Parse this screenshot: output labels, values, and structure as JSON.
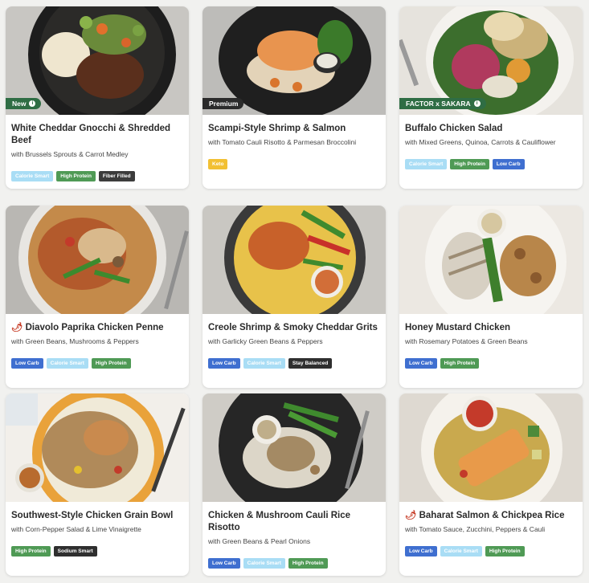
{
  "cards": [
    {
      "title": "White Cheddar Gnocchi & Shredded Beef",
      "subtitle": "with Brussels Sprouts & Carrot Medley",
      "badge": "New",
      "tags": [
        "Calorie Smart",
        "High Protein",
        "Fiber Filled"
      ]
    },
    {
      "title": "Scampi-Style Shrimp & Salmon",
      "subtitle": "with Tomato Cauli Risotto & Parmesan Broccolini",
      "badge": "Premium",
      "tags": [
        "Keto"
      ]
    },
    {
      "title": "Buffalo Chicken Salad",
      "subtitle": "with Mixed Greens, Quinoa, Carrots & Cauliflower",
      "badge": "FACTOR x SAKARA",
      "tags": [
        "Calorie Smart",
        "High Protein",
        "Low Carb"
      ]
    },
    {
      "title": "Diavolo Paprika Chicken Penne",
      "subtitle": "with Green Beans, Mushrooms & Peppers",
      "badge": "",
      "tags": [
        "Low Carb",
        "Calorie Smart",
        "High Protein"
      ]
    },
    {
      "title": "Creole Shrimp & Smoky Cheddar Grits",
      "subtitle": "with Garlicky Green Beans & Peppers",
      "badge": "",
      "tags": [
        "Low Carb",
        "Calorie Smart",
        "Stay Balanced"
      ]
    },
    {
      "title": "Honey Mustard Chicken",
      "subtitle": "with Rosemary Potatoes & Green Beans",
      "badge": "",
      "tags": [
        "Low Carb",
        "High Protein"
      ]
    },
    {
      "title": "Southwest-Style Chicken Grain Bowl",
      "subtitle": "with Corn-Pepper Salad & Lime Vinaigrette",
      "badge": "",
      "tags": [
        "High Protein",
        "Sodium Smart"
      ]
    },
    {
      "title": "Chicken & Mushroom Cauli Rice Risotto",
      "subtitle": "with Green Beans & Pearl Onions",
      "badge": "",
      "tags": [
        "Low Carb",
        "Calorie Smart",
        "High Protein"
      ]
    },
    {
      "title": "Baharat Salmon & Chickpea Rice",
      "subtitle": "with Tomato Sauce, Zucchini, Peppers & Cauli",
      "badge": "",
      "tags": [
        "Low Carb",
        "Calorie Smart",
        "High Protein"
      ]
    }
  ],
  "icons": {
    "spicy": "chili-pepper-icon",
    "info": "info-icon"
  },
  "colors": {
    "calorie_smart": "#a9ddf5",
    "high_protein": "#4f9a55",
    "fiber_filled": "#3c3c3c",
    "keto": "#f2c033",
    "low_carb": "#3f6fd0",
    "stay_balanced": "#2f2f2f",
    "sodium_smart": "#2f2f2f",
    "badge_green": "#2f6d44",
    "badge_dark": "#2b2b2b"
  }
}
